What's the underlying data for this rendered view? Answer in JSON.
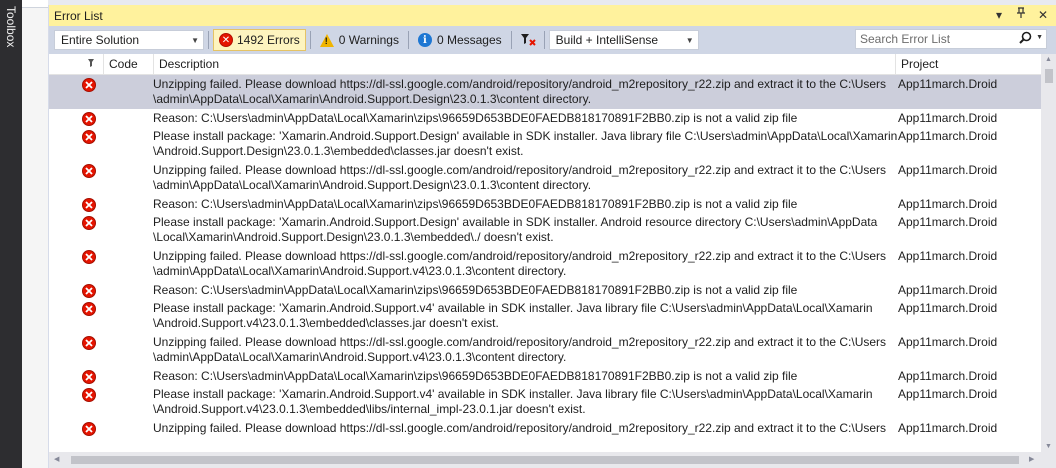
{
  "toolbox": {
    "label": "Toolbox"
  },
  "panel": {
    "title": "Error List",
    "dropdown_icon": "▾",
    "pin_icon": "Ɐ",
    "close_icon": "✕"
  },
  "toolbar": {
    "scope": "Entire Solution",
    "errors": "1492 Errors",
    "warnings": "0 Warnings",
    "messages": "0 Messages",
    "build_filter": "Build + IntelliSense",
    "search_placeholder": "Search Error List"
  },
  "columns": {
    "code": "Code",
    "description": "Description",
    "project": "Project"
  },
  "rows": [
    {
      "desc1": "Unzipping failed. Please download https://dl-ssl.google.com/android/repository/android_m2repository_r22.zip and extract it to the C:\\Users",
      "desc2": "\\admin\\AppData\\Local\\Xamarin\\Android.Support.Design\\23.0.1.3\\content directory.",
      "project": "App11march.Droid"
    },
    {
      "desc1": "Reason: C:\\Users\\admin\\AppData\\Local\\Xamarin\\zips\\96659D653BDE0FAEDB818170891F2BB0.zip is not a valid zip file",
      "desc2": "",
      "project": "App11march.Droid"
    },
    {
      "desc1": "Please install package: 'Xamarin.Android.Support.Design' available in SDK installer. Java library file C:\\Users\\admin\\AppData\\Local\\Xamarin",
      "desc2": "\\Android.Support.Design\\23.0.1.3\\embedded\\classes.jar doesn't exist.",
      "project": "App11march.Droid"
    },
    {
      "desc1": "Unzipping failed. Please download https://dl-ssl.google.com/android/repository/android_m2repository_r22.zip and extract it to the C:\\Users",
      "desc2": "\\admin\\AppData\\Local\\Xamarin\\Android.Support.Design\\23.0.1.3\\content directory.",
      "project": "App11march.Droid"
    },
    {
      "desc1": "Reason: C:\\Users\\admin\\AppData\\Local\\Xamarin\\zips\\96659D653BDE0FAEDB818170891F2BB0.zip is not a valid zip file",
      "desc2": "",
      "project": "App11march.Droid"
    },
    {
      "desc1": "Please install package: 'Xamarin.Android.Support.Design' available in SDK installer. Android resource directory C:\\Users\\admin\\AppData",
      "desc2": "\\Local\\Xamarin\\Android.Support.Design\\23.0.1.3\\embedded\\./ doesn't exist.",
      "project": "App11march.Droid"
    },
    {
      "desc1": "Unzipping failed. Please download https://dl-ssl.google.com/android/repository/android_m2repository_r22.zip and extract it to the C:\\Users",
      "desc2": "\\admin\\AppData\\Local\\Xamarin\\Android.Support.v4\\23.0.1.3\\content directory.",
      "project": "App11march.Droid"
    },
    {
      "desc1": "Reason: C:\\Users\\admin\\AppData\\Local\\Xamarin\\zips\\96659D653BDE0FAEDB818170891F2BB0.zip is not a valid zip file",
      "desc2": "",
      "project": "App11march.Droid"
    },
    {
      "desc1": "Please install package: 'Xamarin.Android.Support.v4' available in SDK installer. Java library file C:\\Users\\admin\\AppData\\Local\\Xamarin",
      "desc2": "\\Android.Support.v4\\23.0.1.3\\embedded\\classes.jar doesn't exist.",
      "project": "App11march.Droid"
    },
    {
      "desc1": "Unzipping failed. Please download https://dl-ssl.google.com/android/repository/android_m2repository_r22.zip and extract it to the C:\\Users",
      "desc2": "\\admin\\AppData\\Local\\Xamarin\\Android.Support.v4\\23.0.1.3\\content directory.",
      "project": "App11march.Droid"
    },
    {
      "desc1": "Reason: C:\\Users\\admin\\AppData\\Local\\Xamarin\\zips\\96659D653BDE0FAEDB818170891F2BB0.zip is not a valid zip file",
      "desc2": "",
      "project": "App11march.Droid"
    },
    {
      "desc1": "Please install package: 'Xamarin.Android.Support.v4' available in SDK installer. Java library file C:\\Users\\admin\\AppData\\Local\\Xamarin",
      "desc2": "\\Android.Support.v4\\23.0.1.3\\embedded\\libs/internal_impl-23.0.1.jar doesn't exist.",
      "project": "App11march.Droid"
    },
    {
      "desc1": "Unzipping failed. Please download https://dl-ssl.google.com/android/repository/android_m2repository_r22.zip and extract it to the C:\\Users",
      "desc2": "",
      "project": "App11march.Droid"
    }
  ],
  "selected_row": 0,
  "colors": {
    "title_bg": "#fff29d",
    "toolbar_bg": "#cfd6e5",
    "selected_row": "#cccedb",
    "error_red": "#e51400"
  }
}
